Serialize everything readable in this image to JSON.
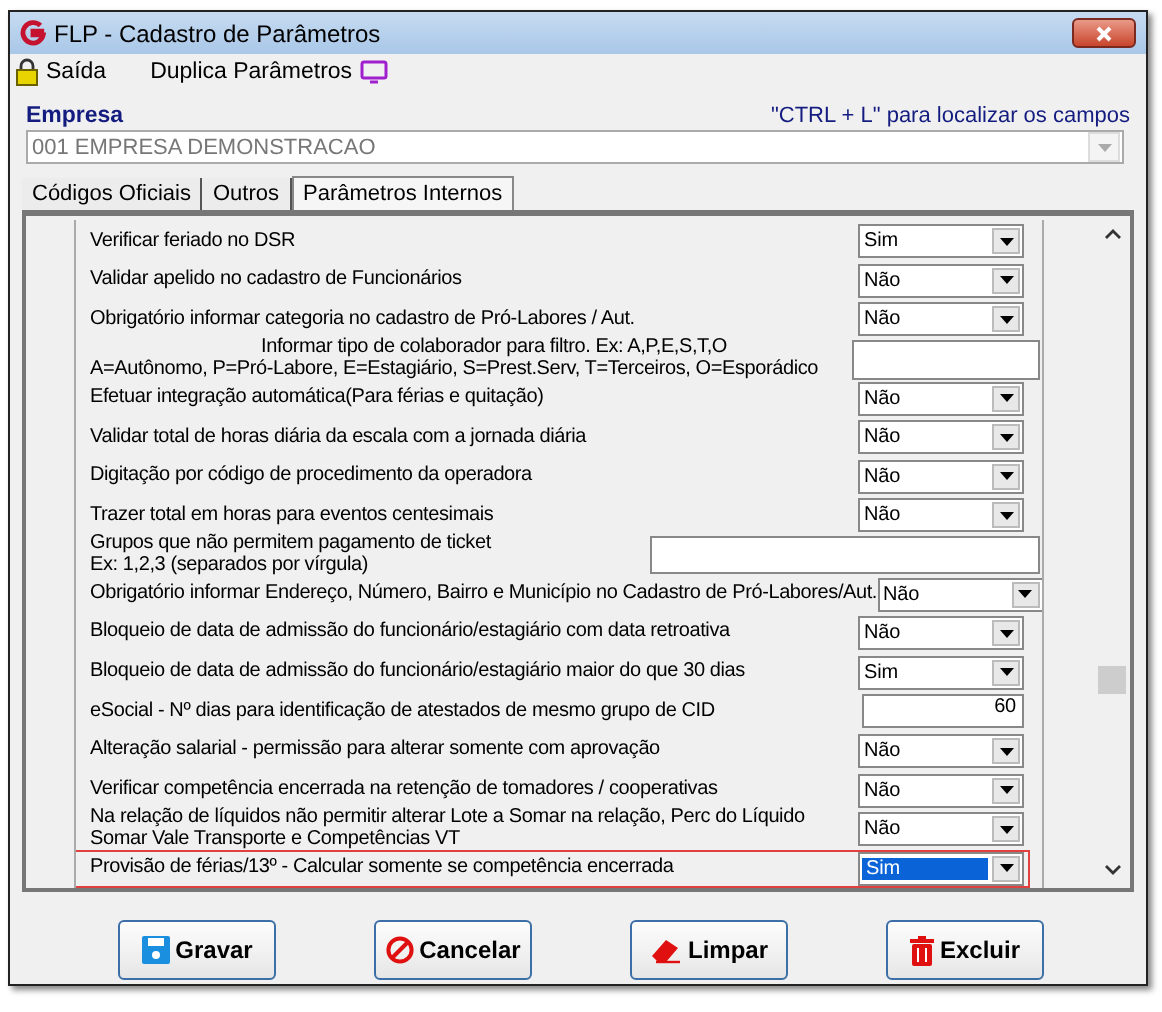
{
  "window": {
    "title": "FLP - Cadastro de Parâmetros"
  },
  "toolbar": [
    {
      "label": "Saída"
    },
    {
      "label": "Duplica Parâmetros"
    }
  ],
  "empresa": {
    "label": "Empresa",
    "hint": "\"CTRL + L\" para localizar os campos",
    "value": "001 EMPRESA DEMONSTRACAO"
  },
  "tabs": [
    {
      "label": "Códigos Oficiais",
      "selected": false
    },
    {
      "label": "Outros",
      "selected": false
    },
    {
      "label": "Parâmetros Internos",
      "selected": true
    }
  ],
  "rows": [
    {
      "kind": "select",
      "lines": [
        "Verificar feriado no DSR"
      ],
      "value": "Sim",
      "highlighted": false
    },
    {
      "kind": "select",
      "lines": [
        "Validar apelido no cadastro de Funcionários"
      ],
      "value": "Não",
      "highlighted": false
    },
    {
      "kind": "select",
      "lines": [
        "Obrigatório informar categoria no cadastro de Pró-Labores / Aut."
      ],
      "value": "Não",
      "highlighted": false
    },
    {
      "kind": "code-input",
      "lines": [
        "Informar tipo de colaborador para filtro. Ex: A,P,E,S,T,O",
        "A=Autônomo, P=Pró-Labore, E=Estagiário, S=Prest.Serv, T=Terceiros, O=Esporádico"
      ],
      "highlighted": false
    },
    {
      "kind": "select",
      "lines": [
        "Efetuar integração automática(Para férias e quitação)"
      ],
      "value": "Não",
      "highlighted": false
    },
    {
      "kind": "select",
      "lines": [
        "Validar total de horas diária da escala com a jornada diária"
      ],
      "value": "Não",
      "highlighted": false
    },
    {
      "kind": "select",
      "lines": [
        "Digitação por código de procedimento da operadora"
      ],
      "value": "Não",
      "highlighted": false
    },
    {
      "kind": "select",
      "lines": [
        "Trazer total em horas para eventos centesimais"
      ],
      "value": "Não",
      "highlighted": false
    },
    {
      "kind": "list-input",
      "lines": [
        "Grupos que não permitem pagamento de ticket",
        "Ex: 1,2,3 (separados por vírgula)"
      ],
      "highlighted": false
    },
    {
      "kind": "select",
      "lines": [
        "Obrigatório informar Endereço, Número, Bairro e Município no Cadastro de Pró-Labores/Aut."
      ],
      "value": "Não",
      "highlighted": false
    },
    {
      "kind": "select",
      "lines": [
        "Bloqueio de data de admissão do funcionário/estagiário com data retroativa"
      ],
      "value": "Não",
      "highlighted": false
    },
    {
      "kind": "select",
      "lines": [
        "Bloqueio de data de admissão do funcionário/estagiário maior do que 30 dias"
      ],
      "value": "Sim",
      "highlighted": false
    },
    {
      "kind": "number",
      "lines": [
        "eSocial - Nº dias para identificação de atestados de mesmo grupo de CID"
      ],
      "value": "60",
      "highlighted": false
    },
    {
      "kind": "select",
      "lines": [
        "Alteração salarial - permissão para alterar somente com aprovação"
      ],
      "value": "Não",
      "highlighted": false
    },
    {
      "kind": "select",
      "lines": [
        "Verificar competência encerrada na retenção de tomadores / cooperativas"
      ],
      "value": "Não",
      "highlighted": false
    },
    {
      "kind": "select",
      "lines": [
        "Na relação de líquidos não permitir alterar Lote a Somar na relação, Perc do Líquido",
        "Somar Vale Transporte e  Competências VT"
      ],
      "value": "Não",
      "highlighted": false
    },
    {
      "kind": "select",
      "lines": [
        "Provisão de férias/13º - Calcular somente se competência encerrada"
      ],
      "value": "Sim",
      "highlighted": true
    }
  ],
  "buttons": [
    {
      "label": "Gravar"
    },
    {
      "label": "Cancelar"
    },
    {
      "label": "Limpar"
    },
    {
      "label": "Excluir"
    }
  ]
}
